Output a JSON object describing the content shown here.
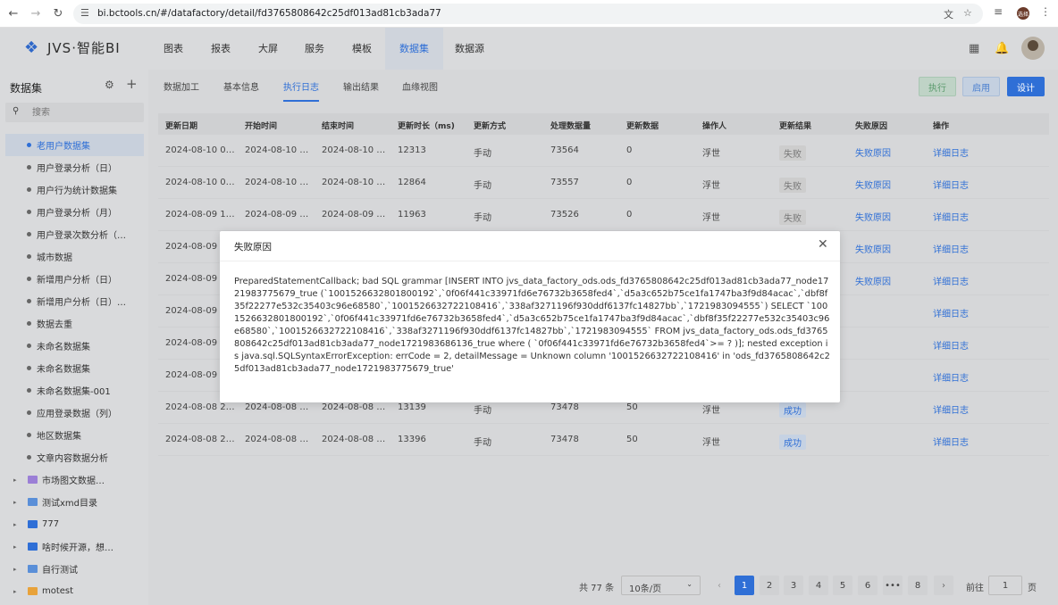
{
  "browser": {
    "url": "bi.bctools.cn/#/datafactory/detail/fd3765808642c25df013ad81cb3ada77",
    "profile_badge": "选择"
  },
  "header": {
    "logo_text": "JVS·智能BI",
    "nav": [
      "图表",
      "报表",
      "大屏",
      "服务",
      "模板",
      "数据集",
      "数据源"
    ],
    "active_nav": "数据集"
  },
  "sidebar": {
    "title": "数据集",
    "search_placeholder": "搜索",
    "items": [
      {
        "label": "老用户数据集",
        "type": "dataset",
        "selected": true
      },
      {
        "label": "用户登录分析（日）",
        "type": "dataset"
      },
      {
        "label": "用户行为统计数据集",
        "type": "dataset"
      },
      {
        "label": "用户登录分析（月）",
        "type": "dataset"
      },
      {
        "label": "用户登录次数分析（…",
        "type": "dataset"
      },
      {
        "label": "城市数据",
        "type": "dataset"
      },
      {
        "label": "新增用户分析（日）",
        "type": "dataset"
      },
      {
        "label": "新增用户分析（日）…",
        "type": "dataset"
      },
      {
        "label": "数据去重",
        "type": "dataset"
      },
      {
        "label": "未命名数据集",
        "type": "dataset"
      },
      {
        "label": "未命名数据集",
        "type": "dataset"
      },
      {
        "label": "未命名数据集-001",
        "type": "dataset"
      },
      {
        "label": "应用登录数据（列）",
        "type": "dataset"
      },
      {
        "label": "地区数据集",
        "type": "dataset"
      },
      {
        "label": "文章内容数据分析",
        "type": "dataset"
      },
      {
        "label": "市场图文数据…",
        "type": "folder",
        "color": "#9b7fd6"
      },
      {
        "label": "测试xmd目录",
        "type": "folder",
        "color": "#5a8fd8"
      },
      {
        "label": "777",
        "type": "folder",
        "color": "#2f6fd6"
      },
      {
        "label": "啥时候开源，想…",
        "type": "folder",
        "color": "#2f6fd6"
      },
      {
        "label": "自行测试",
        "type": "folder",
        "color": "#5a8fd8"
      },
      {
        "label": "motest",
        "type": "folder",
        "color": "#e8a23a"
      }
    ]
  },
  "tabs": [
    "数据加工",
    "基本信息",
    "执行日志",
    "输出结果",
    "血缘视图"
  ],
  "active_tab": "执行日志",
  "actions": {
    "run": "执行",
    "enable": "启用",
    "design": "设计"
  },
  "table": {
    "columns": [
      "更新日期",
      "开始时间",
      "结束时间",
      "更新时长（ms)",
      "更新方式",
      "处理数据量",
      "更新数据",
      "操作人",
      "更新结果",
      "失败原因",
      "操作"
    ],
    "rows": [
      {
        "date": "2024-08-10 0…",
        "start": "2024-08-10 …",
        "end": "2024-08-10 …",
        "duration": "12313",
        "mode": "手动",
        "processed": "73564",
        "updated": "0",
        "user": "浮世",
        "result": "失败",
        "reason": "失败原因",
        "op": "详细日志"
      },
      {
        "date": "2024-08-10 0…",
        "start": "2024-08-10 …",
        "end": "2024-08-10 …",
        "duration": "12864",
        "mode": "手动",
        "processed": "73557",
        "updated": "0",
        "user": "浮世",
        "result": "失败",
        "reason": "失败原因",
        "op": "详细日志"
      },
      {
        "date": "2024-08-09 1…",
        "start": "2024-08-09 …",
        "end": "2024-08-09 …",
        "duration": "11963",
        "mode": "手动",
        "processed": "73526",
        "updated": "0",
        "user": "浮世",
        "result": "失败",
        "reason": "失败原因",
        "op": "详细日志"
      },
      {
        "date": "2024-08-09 1",
        "start": "",
        "end": "",
        "duration": "",
        "mode": "",
        "processed": "",
        "updated": "",
        "user": "",
        "result": "",
        "reason": "失败原因",
        "op": "详细日志"
      },
      {
        "date": "2024-08-09 1",
        "start": "",
        "end": "",
        "duration": "",
        "mode": "",
        "processed": "",
        "updated": "",
        "user": "",
        "result": "",
        "reason": "失败原因",
        "op": "详细日志"
      },
      {
        "date": "2024-08-09 1",
        "start": "",
        "end": "",
        "duration": "",
        "mode": "",
        "processed": "",
        "updated": "",
        "user": "",
        "result": "",
        "reason": "",
        "op": "详细日志"
      },
      {
        "date": "2024-08-09 1",
        "start": "",
        "end": "",
        "duration": "",
        "mode": "",
        "processed": "",
        "updated": "",
        "user": "",
        "result": "",
        "reason": "",
        "op": "详细日志"
      },
      {
        "date": "2024-08-09 0",
        "start": "",
        "end": "",
        "duration": "",
        "mode": "",
        "processed": "",
        "updated": "",
        "user": "",
        "result": "",
        "reason": "",
        "op": "详细日志"
      },
      {
        "date": "2024-08-08 2…",
        "start": "2024-08-08 …",
        "end": "2024-08-08 …",
        "duration": "13139",
        "mode": "手动",
        "processed": "73478",
        "updated": "50",
        "user": "浮世",
        "result": "成功",
        "reason": "",
        "op": "详细日志"
      },
      {
        "date": "2024-08-08 2…",
        "start": "2024-08-08 …",
        "end": "2024-08-08 …",
        "duration": "13396",
        "mode": "手动",
        "processed": "73478",
        "updated": "50",
        "user": "浮世",
        "result": "成功",
        "reason": "",
        "op": "详细日志"
      }
    ]
  },
  "pagination": {
    "total": "共 77 条",
    "page_size": "10条/页",
    "pages": [
      "1",
      "2",
      "3",
      "4",
      "5",
      "6",
      "•••",
      "8"
    ],
    "current": "1",
    "goto_prefix": "前往",
    "goto_value": "1",
    "goto_suffix": "页"
  },
  "modal": {
    "title": "失败原因",
    "body": "PreparedStatementCallback; bad SQL grammar [INSERT INTO jvs_data_factory_ods.ods_fd3765808642c25df013ad81cb3ada77_node1721983775679_true (`1001526632801800192`,`0f06f441c33971fd6e76732b3658fed4`,`d5a3c652b75ce1fa1747ba3f9d84acac`,`dbf8f35f22277e532c35403c96e68580`,`1001526632722108416`,`338af3271196f930ddf6137fc14827bb`,`1721983094555`) SELECT `1001526632801800192`,`0f06f441c33971fd6e76732b3658fed4`,`d5a3c652b75ce1fa1747ba3f9d84acac`,`dbf8f35f22277e532c35403c96e68580`,`1001526632722108416`,`338af3271196f930ddf6137fc14827bb`,`1721983094555` FROM jvs_data_factory_ods.ods_fd3765808642c25df013ad81cb3ada77_node1721983686136_true where ( `0f06f441c33971fd6e76732b3658fed4`>= ? )]; nested exception is java.sql.SQLSyntaxErrorException: errCode = 2, detailMessage = Unknown column '1001526632722108416' in 'ods_fd3765808642c25df013ad81cb3ada77_node1721983775679_true'"
  },
  "icons": [
    "back-icon",
    "forward-icon",
    "reload-icon",
    "tune-icon",
    "translate-icon",
    "star-icon",
    "media-icon",
    "menu-dots-icon",
    "logo-icon",
    "apps-grid-icon",
    "bell-icon",
    "gear-icon",
    "plus-icon",
    "search-icon",
    "close-icon",
    "chevron-left-icon",
    "chevron-right-icon",
    "chevron-down-icon"
  ]
}
